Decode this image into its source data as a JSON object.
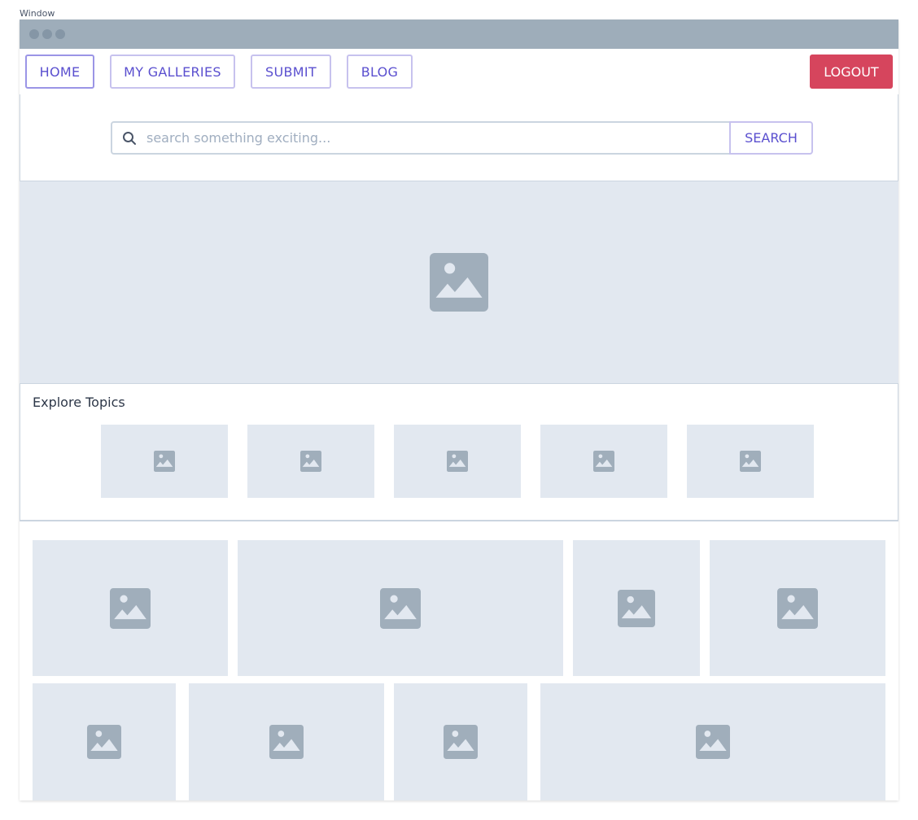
{
  "caption": "Window",
  "nav": {
    "items": [
      {
        "label": "HOME"
      },
      {
        "label": "MY GALLERIES"
      },
      {
        "label": "SUBMIT"
      },
      {
        "label": "BLOG"
      }
    ],
    "logout_label": "LOGOUT"
  },
  "search": {
    "placeholder": "search something exciting...",
    "button_label": "SEARCH",
    "icon": "search-icon"
  },
  "hero": {
    "icon": "image-placeholder-icon"
  },
  "topics": {
    "title": "Explore Topics",
    "tiles": [
      {
        "icon": "image-placeholder-icon"
      },
      {
        "icon": "image-placeholder-icon"
      },
      {
        "icon": "image-placeholder-icon"
      },
      {
        "icon": "image-placeholder-icon"
      },
      {
        "icon": "image-placeholder-icon"
      }
    ]
  },
  "gallery": {
    "row1": [
      {
        "icon": "image-placeholder-icon"
      },
      {
        "icon": "image-placeholder-icon"
      },
      {
        "icon": "image-placeholder-icon"
      },
      {
        "icon": "image-placeholder-icon"
      }
    ],
    "row2": [
      {
        "icon": "image-placeholder-icon"
      },
      {
        "icon": "image-placeholder-icon"
      },
      {
        "icon": "image-placeholder-icon"
      },
      {
        "icon": "image-placeholder-icon"
      }
    ]
  },
  "colors": {
    "accent": "#5a4fcf",
    "danger": "#d6455d",
    "placeholder_bg": "#e2e8f0",
    "placeholder_icon": "#a0aebb",
    "titlebar": "#9eadba"
  }
}
